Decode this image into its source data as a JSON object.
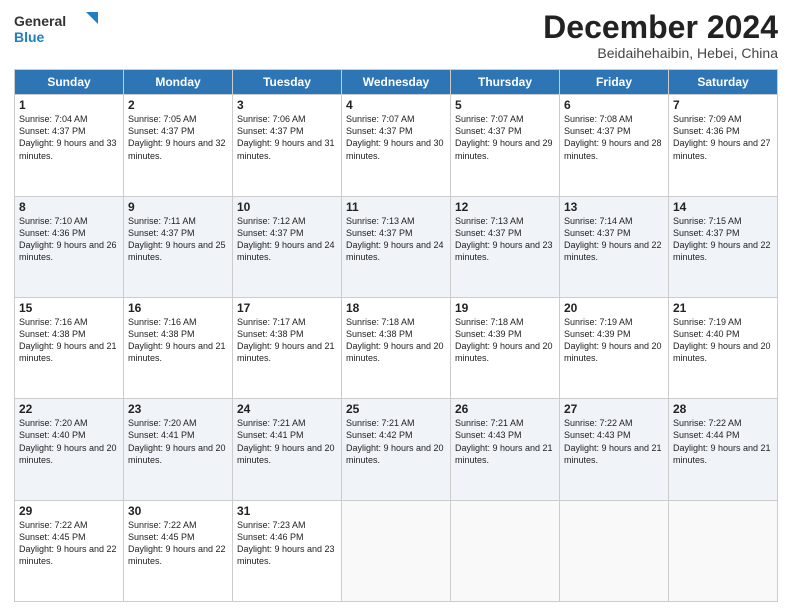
{
  "header": {
    "logo_general": "General",
    "logo_blue": "Blue",
    "month_title": "December 2024",
    "subtitle": "Beidaihehaibin, Hebei, China"
  },
  "days_of_week": [
    "Sunday",
    "Monday",
    "Tuesday",
    "Wednesday",
    "Thursday",
    "Friday",
    "Saturday"
  ],
  "weeks": [
    [
      {
        "day": 1,
        "sunrise": "7:04 AM",
        "sunset": "4:37 PM",
        "daylight": "9 hours and 33 minutes."
      },
      {
        "day": 2,
        "sunrise": "7:05 AM",
        "sunset": "4:37 PM",
        "daylight": "9 hours and 32 minutes."
      },
      {
        "day": 3,
        "sunrise": "7:06 AM",
        "sunset": "4:37 PM",
        "daylight": "9 hours and 31 minutes."
      },
      {
        "day": 4,
        "sunrise": "7:07 AM",
        "sunset": "4:37 PM",
        "daylight": "9 hours and 30 minutes."
      },
      {
        "day": 5,
        "sunrise": "7:07 AM",
        "sunset": "4:37 PM",
        "daylight": "9 hours and 29 minutes."
      },
      {
        "day": 6,
        "sunrise": "7:08 AM",
        "sunset": "4:37 PM",
        "daylight": "9 hours and 28 minutes."
      },
      {
        "day": 7,
        "sunrise": "7:09 AM",
        "sunset": "4:36 PM",
        "daylight": "9 hours and 27 minutes."
      }
    ],
    [
      {
        "day": 8,
        "sunrise": "7:10 AM",
        "sunset": "4:36 PM",
        "daylight": "9 hours and 26 minutes."
      },
      {
        "day": 9,
        "sunrise": "7:11 AM",
        "sunset": "4:37 PM",
        "daylight": "9 hours and 25 minutes."
      },
      {
        "day": 10,
        "sunrise": "7:12 AM",
        "sunset": "4:37 PM",
        "daylight": "9 hours and 24 minutes."
      },
      {
        "day": 11,
        "sunrise": "7:13 AM",
        "sunset": "4:37 PM",
        "daylight": "9 hours and 24 minutes."
      },
      {
        "day": 12,
        "sunrise": "7:13 AM",
        "sunset": "4:37 PM",
        "daylight": "9 hours and 23 minutes."
      },
      {
        "day": 13,
        "sunrise": "7:14 AM",
        "sunset": "4:37 PM",
        "daylight": "9 hours and 22 minutes."
      },
      {
        "day": 14,
        "sunrise": "7:15 AM",
        "sunset": "4:37 PM",
        "daylight": "9 hours and 22 minutes."
      }
    ],
    [
      {
        "day": 15,
        "sunrise": "7:16 AM",
        "sunset": "4:38 PM",
        "daylight": "9 hours and 21 minutes."
      },
      {
        "day": 16,
        "sunrise": "7:16 AM",
        "sunset": "4:38 PM",
        "daylight": "9 hours and 21 minutes."
      },
      {
        "day": 17,
        "sunrise": "7:17 AM",
        "sunset": "4:38 PM",
        "daylight": "9 hours and 21 minutes."
      },
      {
        "day": 18,
        "sunrise": "7:18 AM",
        "sunset": "4:38 PM",
        "daylight": "9 hours and 20 minutes."
      },
      {
        "day": 19,
        "sunrise": "7:18 AM",
        "sunset": "4:39 PM",
        "daylight": "9 hours and 20 minutes."
      },
      {
        "day": 20,
        "sunrise": "7:19 AM",
        "sunset": "4:39 PM",
        "daylight": "9 hours and 20 minutes."
      },
      {
        "day": 21,
        "sunrise": "7:19 AM",
        "sunset": "4:40 PM",
        "daylight": "9 hours and 20 minutes."
      }
    ],
    [
      {
        "day": 22,
        "sunrise": "7:20 AM",
        "sunset": "4:40 PM",
        "daylight": "9 hours and 20 minutes."
      },
      {
        "day": 23,
        "sunrise": "7:20 AM",
        "sunset": "4:41 PM",
        "daylight": "9 hours and 20 minutes."
      },
      {
        "day": 24,
        "sunrise": "7:21 AM",
        "sunset": "4:41 PM",
        "daylight": "9 hours and 20 minutes."
      },
      {
        "day": 25,
        "sunrise": "7:21 AM",
        "sunset": "4:42 PM",
        "daylight": "9 hours and 20 minutes."
      },
      {
        "day": 26,
        "sunrise": "7:21 AM",
        "sunset": "4:43 PM",
        "daylight": "9 hours and 21 minutes."
      },
      {
        "day": 27,
        "sunrise": "7:22 AM",
        "sunset": "4:43 PM",
        "daylight": "9 hours and 21 minutes."
      },
      {
        "day": 28,
        "sunrise": "7:22 AM",
        "sunset": "4:44 PM",
        "daylight": "9 hours and 21 minutes."
      }
    ],
    [
      {
        "day": 29,
        "sunrise": "7:22 AM",
        "sunset": "4:45 PM",
        "daylight": "9 hours and 22 minutes."
      },
      {
        "day": 30,
        "sunrise": "7:22 AM",
        "sunset": "4:45 PM",
        "daylight": "9 hours and 22 minutes."
      },
      {
        "day": 31,
        "sunrise": "7:23 AM",
        "sunset": "4:46 PM",
        "daylight": "9 hours and 23 minutes."
      },
      null,
      null,
      null,
      null
    ]
  ],
  "labels": {
    "sunrise": "Sunrise:",
    "sunset": "Sunset:",
    "daylight": "Daylight:"
  }
}
